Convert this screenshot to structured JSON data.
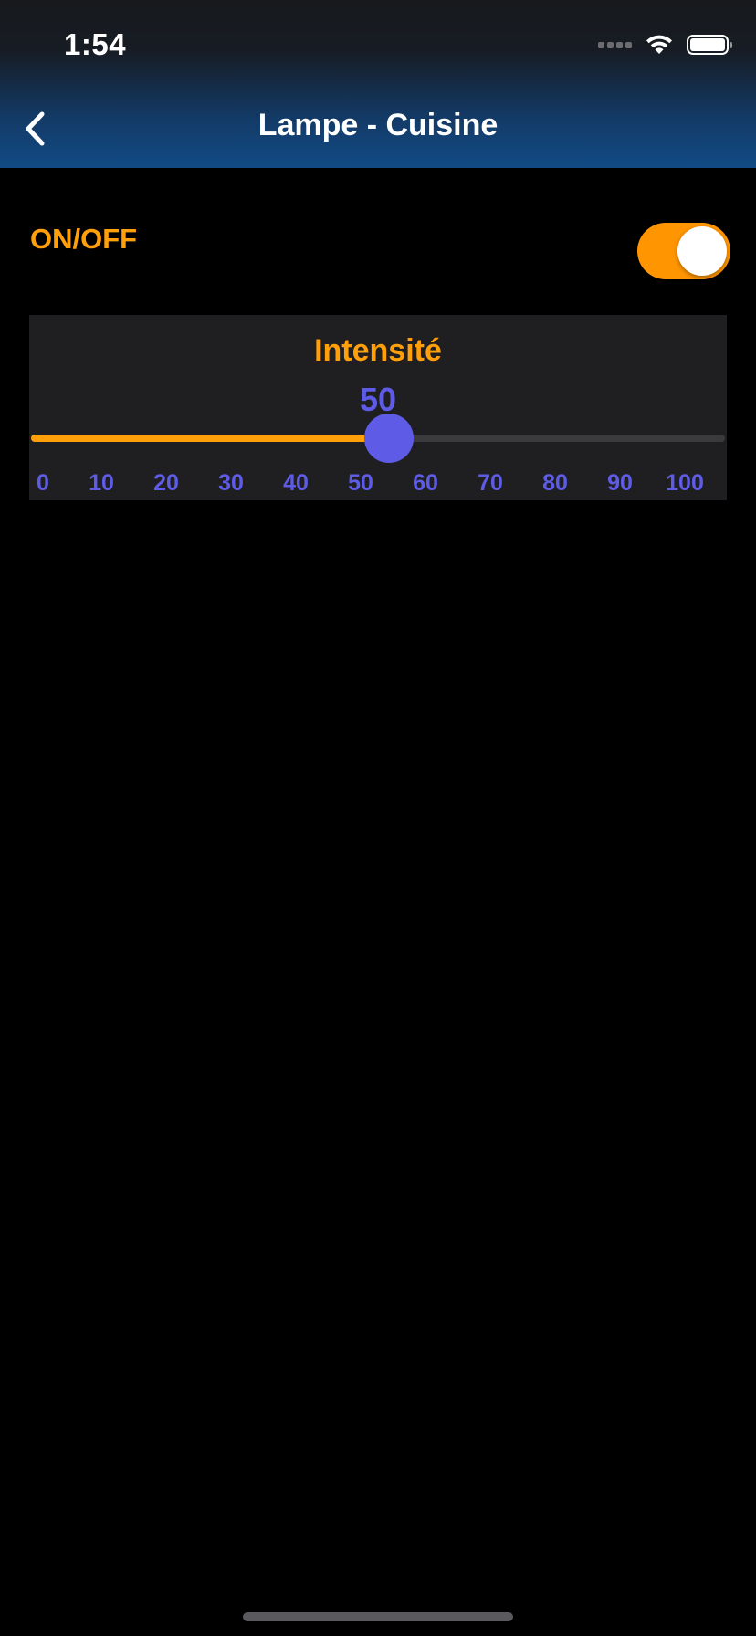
{
  "status_bar": {
    "time": "1:54",
    "icons": [
      "cellular-signal-icon",
      "wifi-icon",
      "battery-icon"
    ]
  },
  "nav": {
    "title": "Lampe - Cuisine",
    "back_icon": "chevron-left-icon"
  },
  "power": {
    "label": "ON/OFF",
    "on": true
  },
  "intensity": {
    "title": "Intensité",
    "value": "50",
    "min": 0,
    "max": 100,
    "tick_labels": [
      "0",
      "10",
      "20",
      "30",
      "40",
      "50",
      "60",
      "70",
      "80",
      "90",
      "100"
    ]
  },
  "colors": {
    "accent_orange": "#ff9f0a",
    "accent_purple": "#5e5ce6",
    "header_blue": "#124b85",
    "background": "#000000",
    "card_background": "#1f1f21"
  }
}
